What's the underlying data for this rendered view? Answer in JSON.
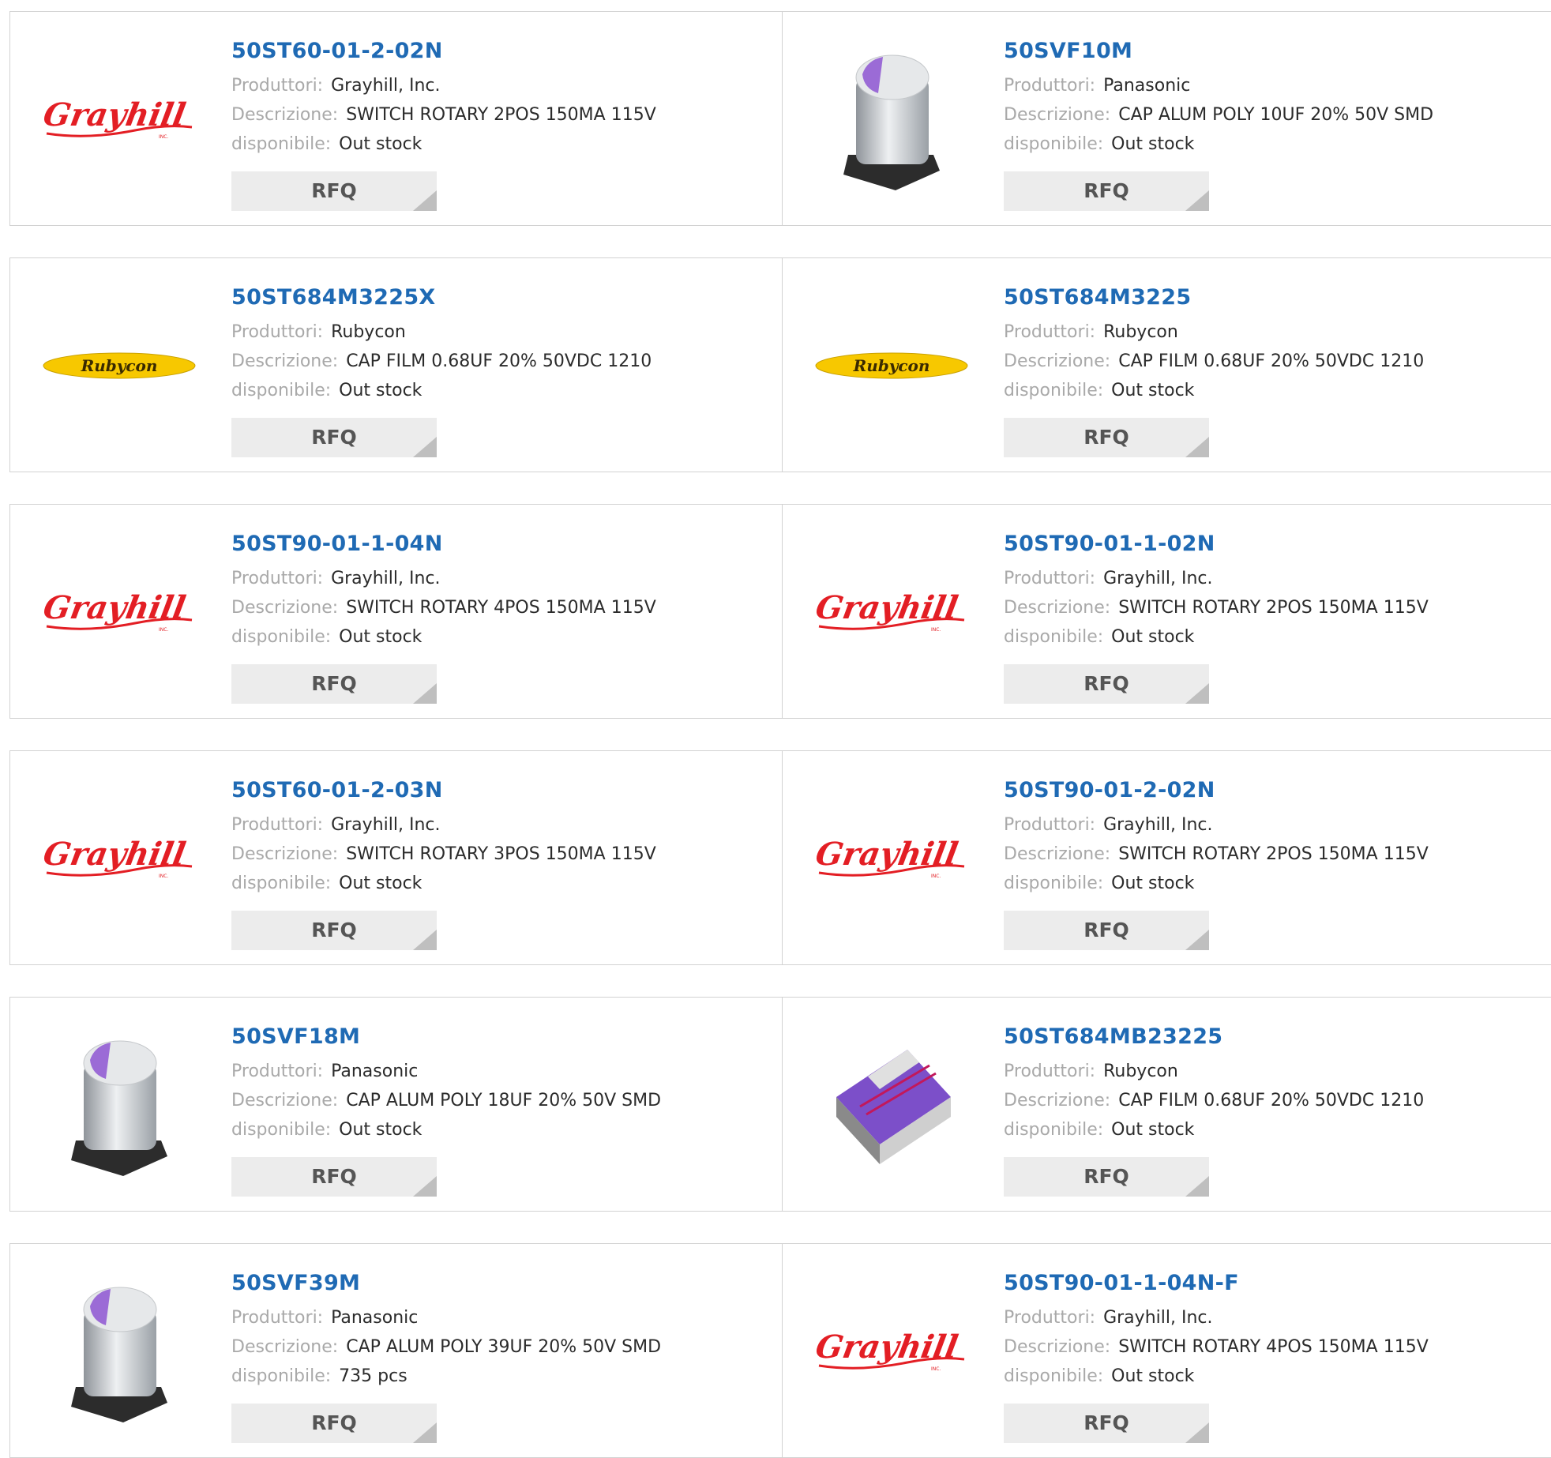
{
  "labels": {
    "manufacturer": "Produttori:",
    "description": "Descrizione:",
    "availability": "disponibile:",
    "rfq": "RFQ"
  },
  "products": [
    {
      "part": "50ST60-01-2-02N",
      "manufacturer": "Grayhill, Inc.",
      "description": "SWITCH ROTARY 2POS 150MA 115V",
      "stock": "Out stock",
      "image": "grayhill-logo"
    },
    {
      "part": "50SVF10M",
      "manufacturer": "Panasonic",
      "description": "CAP ALUM POLY 10UF 20% 50V SMD",
      "stock": "Out stock",
      "image": "capacitor-photo"
    },
    {
      "part": "50ST684M3225X",
      "manufacturer": "Rubycon",
      "description": "CAP FILM 0.68UF 20% 50VDC 1210",
      "stock": "Out stock",
      "image": "rubycon-logo"
    },
    {
      "part": "50ST684M3225",
      "manufacturer": "Rubycon",
      "description": "CAP FILM 0.68UF 20% 50VDC 1210",
      "stock": "Out stock",
      "image": "rubycon-logo"
    },
    {
      "part": "50ST90-01-1-04N",
      "manufacturer": "Grayhill, Inc.",
      "description": "SWITCH ROTARY 4POS 150MA 115V",
      "stock": "Out stock",
      "image": "grayhill-logo"
    },
    {
      "part": "50ST90-01-1-02N",
      "manufacturer": "Grayhill, Inc.",
      "description": "SWITCH ROTARY 2POS 150MA 115V",
      "stock": "Out stock",
      "image": "grayhill-logo"
    },
    {
      "part": "50ST60-01-2-03N",
      "manufacturer": "Grayhill, Inc.",
      "description": "SWITCH ROTARY 3POS 150MA 115V",
      "stock": "Out stock",
      "image": "grayhill-logo"
    },
    {
      "part": "50ST90-01-2-02N",
      "manufacturer": "Grayhill, Inc.",
      "description": "SWITCH ROTARY 2POS 150MA 115V",
      "stock": "Out stock",
      "image": "grayhill-logo"
    },
    {
      "part": "50SVF18M",
      "manufacturer": "Panasonic",
      "description": "CAP ALUM POLY 18UF 20% 50V SMD",
      "stock": "Out stock",
      "image": "capacitor-photo"
    },
    {
      "part": "50ST684MB23225",
      "manufacturer": "Rubycon",
      "description": "CAP FILM 0.68UF 20% 50VDC 1210",
      "stock": "Out stock",
      "image": "film-chip-photo"
    },
    {
      "part": "50SVF39M",
      "manufacturer": "Panasonic",
      "description": "CAP ALUM POLY 39UF 20% 50V SMD",
      "stock": "735 pcs",
      "image": "capacitor-photo"
    },
    {
      "part": "50ST90-01-1-04N-F",
      "manufacturer": "Grayhill, Inc.",
      "description": "SWITCH ROTARY 4POS 150MA 115V",
      "stock": "Out stock",
      "image": "grayhill-logo"
    }
  ],
  "brand_logos": {
    "grayhill-logo": "Grayhill",
    "rubycon-logo": "Rubycon"
  },
  "colors": {
    "link": "#1f6ab4",
    "grayhill_red": "#e31e24",
    "rubycon_yellow": "#f7c800",
    "capacitor_purple": "#9b6bd6"
  }
}
